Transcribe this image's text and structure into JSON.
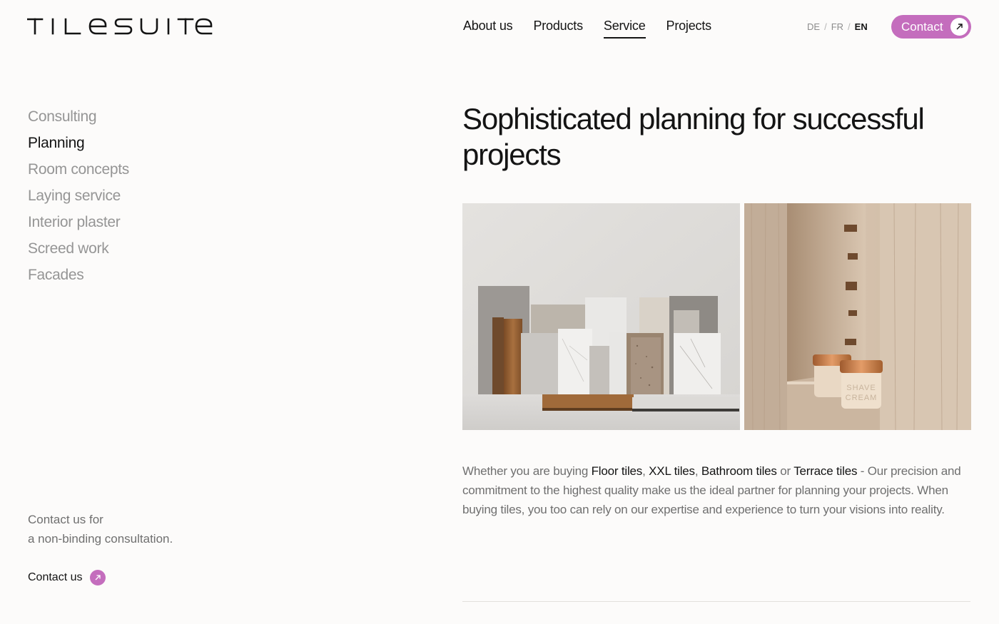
{
  "brand": {
    "logo_text": "TILESUITE"
  },
  "nav": {
    "items": [
      {
        "label": "About us"
      },
      {
        "label": "Products"
      },
      {
        "label": "Service",
        "active": true
      },
      {
        "label": "Projects"
      }
    ]
  },
  "languages": {
    "de": "DE",
    "fr": "FR",
    "en": "EN",
    "separator": "/"
  },
  "header": {
    "contact_label": "Contact",
    "contact_icon": "arrow-up-right-icon"
  },
  "sidebar": {
    "items": [
      {
        "label": "Consulting"
      },
      {
        "label": "Planning",
        "active": true
      },
      {
        "label": "Room concepts"
      },
      {
        "label": "Laying service"
      },
      {
        "label": "Interior plaster"
      },
      {
        "label": "Screed work"
      },
      {
        "label": "Facades"
      }
    ],
    "contact_line1": "Contact us for",
    "contact_line2": "a non-binding consultation.",
    "contact_link": "Contact us"
  },
  "main": {
    "headline": "Sophisticated planning for successful projects",
    "body": {
      "intro": "Whether you are buying ",
      "link1": "Floor tiles",
      "sep1": ", ",
      "link2": "XXL tiles",
      "sep2": ", ",
      "link3": "Bathroom tiles",
      "or": " or ",
      "link4": "Terrace tiles",
      "rest": " - Our precision and commitment to the highest quality make us the ideal partner for planning your projects. When buying tiles, you too can rely on our expertise and experience to turn your visions into reality."
    },
    "image_right_text": "SHAVE CREAM"
  },
  "colors": {
    "accent": "#c46dbd",
    "text": "#141414",
    "muted": "#959595",
    "background": "#fcfbfa"
  }
}
